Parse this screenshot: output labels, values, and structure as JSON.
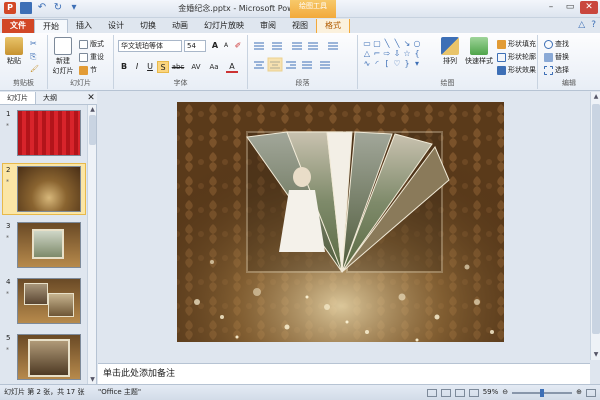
{
  "window": {
    "title": "金婚纪念.pptx - Microsoft PowerPoint",
    "context_tool": "绘图工具"
  },
  "quick_access": {
    "logo": "P",
    "undo": "↶",
    "redo": "↻",
    "more": "▾"
  },
  "window_buttons": {
    "minimize": "–",
    "maximize": "▭",
    "close": "✕"
  },
  "tabs": [
    {
      "label": "文件"
    },
    {
      "label": "开始"
    },
    {
      "label": "插入"
    },
    {
      "label": "设计"
    },
    {
      "label": "切换"
    },
    {
      "label": "动画"
    },
    {
      "label": "幻灯片放映"
    },
    {
      "label": "审阅"
    },
    {
      "label": "视图"
    },
    {
      "label": "格式"
    }
  ],
  "tab_right": {
    "collapse": "△",
    "help": "?"
  },
  "ribbon": {
    "clipboard": {
      "label": "剪贴板",
      "paste": "粘贴",
      "cut": "✂",
      "copy": "⎘",
      "painter": "🖌"
    },
    "slides": {
      "label": "幻灯片",
      "new_slide": "新建",
      "new_slide2": "幻灯片",
      "layout": "版式",
      "reset": "重设",
      "section": "节"
    },
    "font": {
      "label": "字体",
      "font_name": "华文琥珀等体",
      "font_size": "54",
      "grow": "A",
      "shrink": "A",
      "clear": "✐",
      "bold": "B",
      "italic": "I",
      "underline": "U",
      "shadow": "S",
      "strike": "abc",
      "spacing": "AV",
      "case": "Aa",
      "color": "A"
    },
    "paragraph": {
      "label": "段落"
    },
    "drawing": {
      "label": "绘图",
      "arrange": "排列",
      "quick_styles": "快速样式",
      "fill": "形状填充",
      "outline": "形状轮廓",
      "effects": "形状效果"
    },
    "editing": {
      "label": "编辑",
      "find": "查找",
      "replace": "替换",
      "select": "选择"
    }
  },
  "left_panel": {
    "tab_slides": "幻灯片",
    "tab_outline": "大纲",
    "close": "✕",
    "slides": [
      {
        "num": "1",
        "star": "⁎"
      },
      {
        "num": "2",
        "star": "⁎"
      },
      {
        "num": "3",
        "star": "⁎"
      },
      {
        "num": "4",
        "star": "⁎"
      },
      {
        "num": "5",
        "star": "⁎"
      }
    ]
  },
  "notes": {
    "placeholder": "单击此处添加备注"
  },
  "status": {
    "slide_info": "幻灯片 第 2 张，共 17 张",
    "theme": "\"Office 主题\"",
    "zoom": "59%",
    "minus": "⊖",
    "plus": "⊕"
  },
  "colors": {
    "file_tab": "#d24726",
    "accent": "#3d6fb6",
    "context_tab": "#f2a93b"
  }
}
